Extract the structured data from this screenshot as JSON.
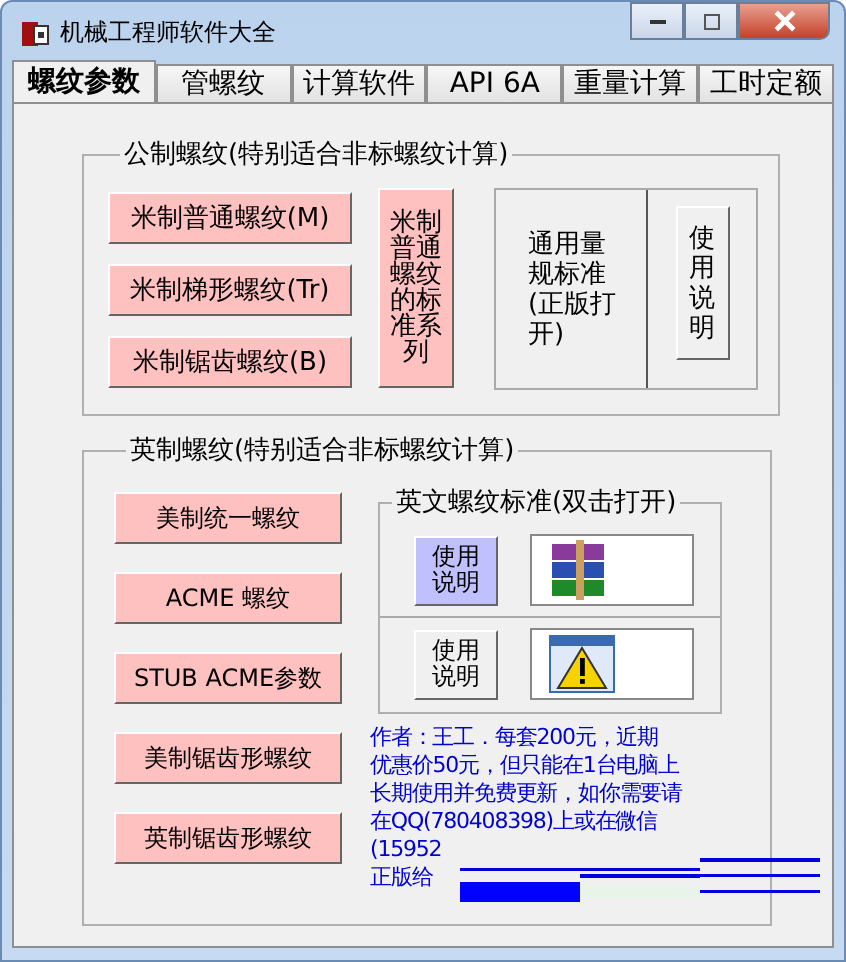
{
  "window": {
    "title": "机械工程师软件大全"
  },
  "tabs": [
    {
      "label": "螺纹参数",
      "selected": true
    },
    {
      "label": "管螺纹",
      "selected": false
    },
    {
      "label": "计算软件",
      "selected": false
    },
    {
      "label": "API 6A",
      "selected": false
    },
    {
      "label": "重量计算",
      "selected": false
    },
    {
      "label": "工时定额",
      "selected": false
    }
  ],
  "metric_group": {
    "title": "公制螺纹(特别适合非标螺纹计算)",
    "buttons": [
      "米制普通螺纹(M)",
      "米制梯形螺纹(Tr)",
      "米制锯齿螺纹(B)"
    ],
    "series_button": "米制普通螺纹的标准系列",
    "gauge_button": "通用量规标准(正版打开)",
    "help_button": "使用说明"
  },
  "imperial_group": {
    "title": "英制螺纹(特别适合非标螺纹计算)",
    "buttons": [
      "美制统一螺纹",
      "ACME 螺纹",
      "STUB ACME参数",
      "美制锯齿形螺纹",
      "英制锯齿形螺纹"
    ],
    "standards": {
      "title": "英文螺纹标准(双击打开)",
      "rows": [
        {
          "help_button": "使用说明",
          "selected": true,
          "kind": "archive"
        },
        {
          "help_button": "使用说明",
          "selected": false,
          "kind": "warning"
        }
      ]
    }
  },
  "notice": {
    "lines": [
      "作者：王工．每套200元，近期",
      "优惠价50元，但只能在1台电脑上",
      "长期使用并免费更新，如你需要请",
      "在QQ(780408398)上或在微信",
      "(15952",
      "正版给"
    ]
  }
}
